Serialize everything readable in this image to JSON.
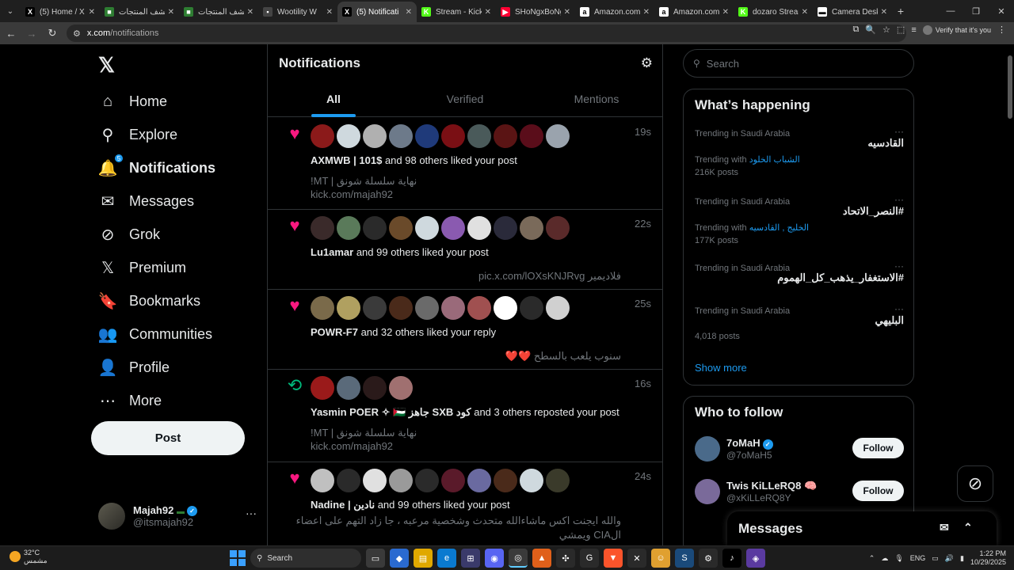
{
  "browser": {
    "tabs": [
      {
        "title": "(5) Home / X",
        "fav": "X",
        "fav_color": "#000000"
      },
      {
        "title": "اكتشف المنتجات",
        "fav": "■",
        "fav_color": "#2e7d32"
      },
      {
        "title": "اكتشف المنتجات",
        "fav": "■",
        "fav_color": "#2e7d32"
      },
      {
        "title": "Wootility W",
        "fav": "▪",
        "fav_color": "#444444"
      },
      {
        "title": "(5) Notificati",
        "fav": "X",
        "fav_color": "#000000",
        "active": true
      },
      {
        "title": "Stream - Kick D",
        "fav": "K",
        "fav_color": "#53fc18"
      },
      {
        "title": "SHoNgxBoNg",
        "fav": "▶",
        "fav_color": "#ff0033"
      },
      {
        "title": "Amazon.com",
        "fav": "a",
        "fav_color": "#ffffff"
      },
      {
        "title": "Amazon.com",
        "fav": "a",
        "fav_color": "#ffffff"
      },
      {
        "title": "dozaro Stream",
        "fav": "K",
        "fav_color": "#53fc18"
      },
      {
        "title": "Camera Desk",
        "fav": "▬",
        "fav_color": "#ffffff"
      }
    ],
    "url_site": "x.com",
    "url_path": "/notifications",
    "verify_label": "Verify that it's you"
  },
  "nav": {
    "items": [
      {
        "label": "Home",
        "icon": "home-icon",
        "glyph": "⌂"
      },
      {
        "label": "Explore",
        "icon": "search-icon",
        "glyph": "⚲"
      },
      {
        "label": "Notifications",
        "icon": "bell-icon",
        "glyph": "🔔",
        "badge": "5",
        "active": true
      },
      {
        "label": "Messages",
        "icon": "envelope-icon",
        "glyph": "✉"
      },
      {
        "label": "Grok",
        "icon": "grok-icon",
        "glyph": "⊘"
      },
      {
        "label": "Premium",
        "icon": "x-premium-icon",
        "glyph": "𝕏"
      },
      {
        "label": "Bookmarks",
        "icon": "bookmark-icon",
        "glyph": "🔖"
      },
      {
        "label": "Communities",
        "icon": "communities-icon",
        "glyph": "👥"
      },
      {
        "label": "Profile",
        "icon": "profile-icon",
        "glyph": "👤"
      },
      {
        "label": "More",
        "icon": "more-circle-icon",
        "glyph": "⋯"
      }
    ],
    "post_label": "Post",
    "account": {
      "name": "Majah92",
      "handle": "@itsmajah92"
    }
  },
  "notifications": {
    "title": "Notifications",
    "tabs": [
      "All",
      "Verified",
      "Mentions"
    ],
    "items": [
      {
        "kind": "like",
        "time": "19s",
        "actor": "AXMWB | 101$",
        "rest": " and 98 others liked your post",
        "sub1": "!MT | نهاية سلسلة شونق",
        "sub2": "kick.com/majah92",
        "avatars": [
          "#8b1a1a",
          "#cfd9de",
          "#b0b0b0",
          "#6d7a8a",
          "#1f3a7a",
          "#7a0f14",
          "#4a5a5a",
          "#5a1414",
          "#5a0d1a",
          "#9aa3ad"
        ]
      },
      {
        "kind": "like",
        "time": "22s",
        "actor": "Lu1amar",
        "rest": " and 99 others liked your post",
        "sub1": "فلاديمير pic.x.com/lOXsKNJRvg",
        "sub2": "",
        "avatars": [
          "#3a2a2a",
          "#5a7a5a",
          "#2a2a2a",
          "#6a4a2a",
          "#cfd9de",
          "#8a5ab0",
          "#e0e0e0",
          "#2a2a3a",
          "#7a6a5a",
          "#5a2a2a"
        ]
      },
      {
        "kind": "like",
        "time": "25s",
        "actor": "POWR-F7",
        "rest": " and 32 others liked your reply",
        "sub1": "سنوب يلعب بالسطح ❤️❤️",
        "sub2": "",
        "avatars": [
          "#7a6a4a",
          "#b0a060",
          "#3a3a3a",
          "#4a2a1a",
          "#6a6a6a",
          "#9a6a7a",
          "#a05050",
          "#ffffff",
          "#2a2a2a",
          "#d0d0d0"
        ]
      },
      {
        "kind": "repost",
        "time": "16s",
        "actor": "Yasmin POER ✧ 🇵🇸 جاهز SXB كود",
        "rest": " and 3 others reposted your post",
        "sub1": "!MT | نهاية سلسلة شونق",
        "sub2": "kick.com/majah92",
        "avatars": [
          "#9a1a1a",
          "#5a6a7a",
          "#2a1a1a",
          "#a07070"
        ]
      },
      {
        "kind": "like",
        "time": "24s",
        "actor": "Nadine | نادين",
        "rest": " and 99 others liked your post",
        "sub1": "والله ايجنت اكس ماشاءالله متحدث وشخصية مرعبه ، جا زاد التهم على اعضاء",
        "sub2": "الCIA ويمشي",
        "avatars": [
          "#c0c0c0",
          "#2a2a2a",
          "#e0e0e0",
          "#9a9a9a",
          "#2a2a2a",
          "#5a1a2a",
          "#6a6aa0",
          "#4a2a1a",
          "#cfd9de",
          "#3a3a2a"
        ]
      }
    ]
  },
  "right": {
    "search_placeholder": "Search",
    "happening_title": "What’s happening",
    "trends": [
      {
        "context": "Trending in Saudi Arabia",
        "name": "القادسيه",
        "with_label": "Trending with",
        "with_link": "الشباب الخلود",
        "posts": "216K posts"
      },
      {
        "context": "Trending in Saudi Arabia",
        "name": "#النصر_الاتحاد",
        "with_label": "Trending with",
        "with_link": "الخليج , القادسيه",
        "posts": "177K posts"
      },
      {
        "context": "Trending in Saudi Arabia",
        "name": "#الاستغفار_يذهب_كل_الهموم",
        "with_label": "",
        "with_link": "",
        "posts": ""
      },
      {
        "context": "Trending in Saudi Arabia",
        "name": "البليهي",
        "with_label": "",
        "with_link": "",
        "posts": "4,018 posts"
      }
    ],
    "show_more": "Show more",
    "who_to_follow_title": "Who to follow",
    "follow": [
      {
        "name": "7oMaH",
        "handle": "@7oMaH5",
        "button": "Follow",
        "verified": true,
        "color": "#4a6a8a"
      },
      {
        "name": "Twis KiLLeRQ8 🧠",
        "handle": "@xKiLLeRQ8Y",
        "button": "Follow",
        "verified": false,
        "color": "#7a6a9a"
      }
    ]
  },
  "messages_drawer": {
    "title": "Messages"
  },
  "taskbar": {
    "temp": "32°C",
    "weather": "مشمس",
    "search": "Search",
    "lang": "ENG",
    "time": "1:22 PM",
    "date": "10/29/2025"
  },
  "colors": {
    "accent": "#1d9bf0",
    "like": "#f91880",
    "repost": "#00ba7c",
    "border": "#2f3336"
  }
}
